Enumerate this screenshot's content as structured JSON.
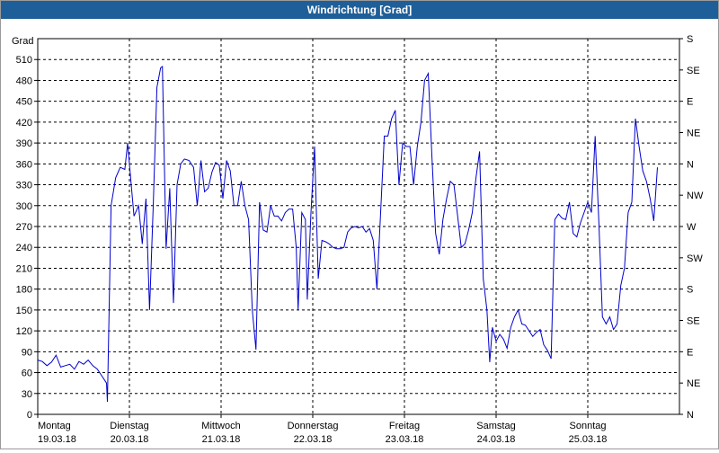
{
  "window": {
    "title": "Windrichtung [Grad]"
  },
  "chart_data": {
    "type": "line",
    "title": "Windrichtung [Grad]",
    "ylabel": "Grad",
    "ylim": [
      0,
      540
    ],
    "yticks": [
      0,
      30,
      60,
      90,
      120,
      150,
      180,
      210,
      240,
      270,
      300,
      330,
      360,
      390,
      420,
      450,
      480,
      510
    ],
    "right_axis": {
      "ticks": [
        0,
        45,
        90,
        135,
        180,
        225,
        270,
        315,
        360,
        405,
        450,
        495,
        540
      ],
      "labels": [
        "N",
        "NE",
        "E",
        "SE",
        "S",
        "SW",
        "W",
        "NW",
        "N",
        "NE",
        "E",
        "SE",
        "S"
      ]
    },
    "xlim": [
      0,
      7
    ],
    "x_labels": [
      {
        "x": 0,
        "day": "Montag",
        "date": "19.03.18"
      },
      {
        "x": 1,
        "day": "Dienstag",
        "date": "20.03.18"
      },
      {
        "x": 2,
        "day": "Mittwoch",
        "date": "21.03.18"
      },
      {
        "x": 3,
        "day": "Donnerstag",
        "date": "22.03.18"
      },
      {
        "x": 4,
        "day": "Freitag",
        "date": "23.03.18"
      },
      {
        "x": 5,
        "day": "Samstag",
        "date": "24.03.18"
      },
      {
        "x": 6,
        "day": "Sonntag",
        "date": "25.03.18"
      }
    ],
    "grid": true,
    "line_color": "#0000cc",
    "series": [
      {
        "points": [
          [
            0.0,
            78
          ],
          [
            0.05,
            76
          ],
          [
            0.1,
            70
          ],
          [
            0.15,
            75
          ],
          [
            0.2,
            85
          ],
          [
            0.25,
            68
          ],
          [
            0.3,
            70
          ],
          [
            0.35,
            72
          ],
          [
            0.4,
            65
          ],
          [
            0.45,
            76
          ],
          [
            0.5,
            72
          ],
          [
            0.55,
            78
          ],
          [
            0.6,
            70
          ],
          [
            0.65,
            65
          ],
          [
            0.7,
            55
          ],
          [
            0.75,
            45
          ],
          [
            0.76,
            18
          ],
          [
            0.8,
            300
          ],
          [
            0.85,
            340
          ],
          [
            0.9,
            355
          ],
          [
            0.95,
            352
          ],
          [
            0.98,
            390
          ],
          [
            1.02,
            330
          ],
          [
            1.05,
            285
          ],
          [
            1.1,
            300
          ],
          [
            1.14,
            245
          ],
          [
            1.18,
            310
          ],
          [
            1.22,
            150
          ],
          [
            1.26,
            300
          ],
          [
            1.3,
            470
          ],
          [
            1.34,
            498
          ],
          [
            1.36,
            500
          ],
          [
            1.4,
            238
          ],
          [
            1.44,
            325
          ],
          [
            1.48,
            160
          ],
          [
            1.52,
            330
          ],
          [
            1.56,
            360
          ],
          [
            1.6,
            367
          ],
          [
            1.65,
            365
          ],
          [
            1.7,
            355
          ],
          [
            1.74,
            300
          ],
          [
            1.78,
            365
          ],
          [
            1.82,
            320
          ],
          [
            1.86,
            325
          ],
          [
            1.9,
            348
          ],
          [
            1.94,
            362
          ],
          [
            1.98,
            358
          ],
          [
            2.02,
            310
          ],
          [
            2.06,
            365
          ],
          [
            2.1,
            350
          ],
          [
            2.14,
            300
          ],
          [
            2.18,
            300
          ],
          [
            2.22,
            335
          ],
          [
            2.26,
            300
          ],
          [
            2.3,
            280
          ],
          [
            2.34,
            150
          ],
          [
            2.38,
            93
          ],
          [
            2.42,
            305
          ],
          [
            2.46,
            265
          ],
          [
            2.5,
            262
          ],
          [
            2.54,
            300
          ],
          [
            2.58,
            285
          ],
          [
            2.62,
            285
          ],
          [
            2.66,
            278
          ],
          [
            2.7,
            290
          ],
          [
            2.74,
            295
          ],
          [
            2.78,
            295
          ],
          [
            2.82,
            240
          ],
          [
            2.84,
            150
          ],
          [
            2.88,
            290
          ],
          [
            2.92,
            280
          ],
          [
            2.94,
            165
          ],
          [
            2.98,
            290
          ],
          [
            3.02,
            385
          ],
          [
            3.06,
            195
          ],
          [
            3.1,
            250
          ],
          [
            3.14,
            248
          ],
          [
            3.18,
            245
          ],
          [
            3.22,
            240
          ],
          [
            3.26,
            238
          ],
          [
            3.3,
            238
          ],
          [
            3.34,
            240
          ],
          [
            3.38,
            262
          ],
          [
            3.42,
            268
          ],
          [
            3.46,
            270
          ],
          [
            3.5,
            268
          ],
          [
            3.54,
            270
          ],
          [
            3.58,
            262
          ],
          [
            3.62,
            267
          ],
          [
            3.66,
            250
          ],
          [
            3.7,
            180
          ],
          [
            3.74,
            290
          ],
          [
            3.78,
            400
          ],
          [
            3.82,
            400
          ],
          [
            3.86,
            425
          ],
          [
            3.9,
            437
          ],
          [
            3.94,
            330
          ],
          [
            3.98,
            390
          ],
          [
            4.02,
            385
          ],
          [
            4.06,
            385
          ],
          [
            4.1,
            330
          ],
          [
            4.14,
            385
          ],
          [
            4.18,
            420
          ],
          [
            4.22,
            480
          ],
          [
            4.26,
            490
          ],
          [
            4.3,
            370
          ],
          [
            4.34,
            260
          ],
          [
            4.38,
            230
          ],
          [
            4.42,
            280
          ],
          [
            4.46,
            310
          ],
          [
            4.5,
            335
          ],
          [
            4.54,
            330
          ],
          [
            4.58,
            285
          ],
          [
            4.62,
            240
          ],
          [
            4.66,
            245
          ],
          [
            4.7,
            265
          ],
          [
            4.74,
            290
          ],
          [
            4.78,
            340
          ],
          [
            4.82,
            378
          ],
          [
            4.86,
            195
          ],
          [
            4.9,
            150
          ],
          [
            4.93,
            75
          ],
          [
            4.96,
            125
          ],
          [
            5.0,
            105
          ],
          [
            5.04,
            115
          ],
          [
            5.08,
            108
          ],
          [
            5.12,
            95
          ],
          [
            5.16,
            125
          ],
          [
            5.2,
            140
          ],
          [
            5.24,
            150
          ],
          [
            5.28,
            130
          ],
          [
            5.32,
            128
          ],
          [
            5.36,
            120
          ],
          [
            5.4,
            112
          ],
          [
            5.44,
            118
          ],
          [
            5.48,
            122
          ],
          [
            5.52,
            100
          ],
          [
            5.56,
            92
          ],
          [
            5.6,
            80
          ],
          [
            5.64,
            280
          ],
          [
            5.68,
            288
          ],
          [
            5.72,
            282
          ],
          [
            5.76,
            280
          ],
          [
            5.8,
            305
          ],
          [
            5.84,
            260
          ],
          [
            5.88,
            255
          ],
          [
            5.92,
            275
          ],
          [
            5.96,
            290
          ],
          [
            6.0,
            305
          ],
          [
            6.04,
            290
          ],
          [
            6.08,
            400
          ],
          [
            6.12,
            280
          ],
          [
            6.16,
            140
          ],
          [
            6.2,
            130
          ],
          [
            6.24,
            140
          ],
          [
            6.28,
            122
          ],
          [
            6.32,
            130
          ],
          [
            6.36,
            185
          ],
          [
            6.4,
            210
          ],
          [
            6.44,
            290
          ],
          [
            6.48,
            305
          ],
          [
            6.52,
            425
          ],
          [
            6.56,
            385
          ],
          [
            6.6,
            350
          ],
          [
            6.64,
            335
          ],
          [
            6.68,
            310
          ],
          [
            6.72,
            278
          ],
          [
            6.76,
            355
          ]
        ]
      }
    ]
  }
}
